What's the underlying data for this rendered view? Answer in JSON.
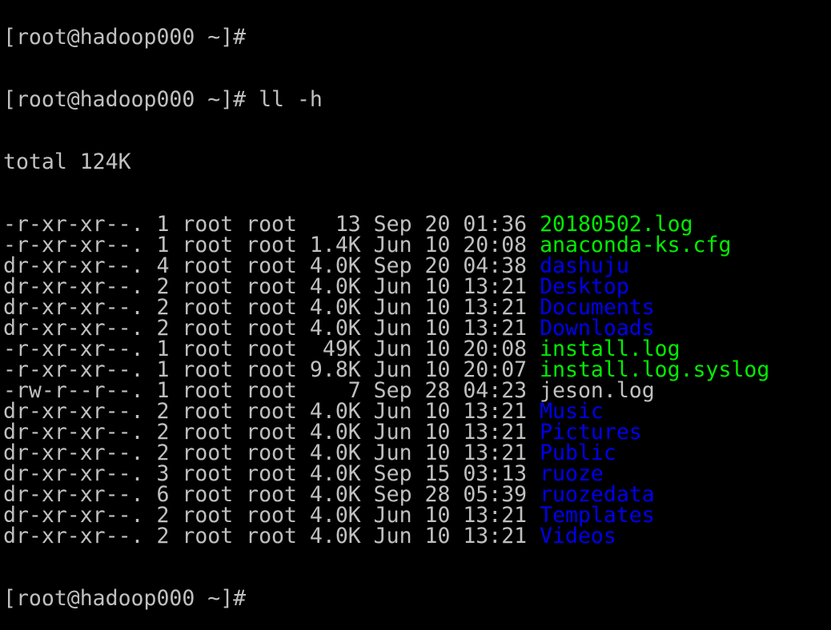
{
  "terminal": {
    "prev_prompt": "[root@hadoop000 ~]#",
    "prompt": "[root@hadoop000 ~]# ",
    "command": "ll -h",
    "total": "total 124K",
    "colors": {
      "normal": "#c0c0c0",
      "executable": "#00ee00",
      "directory": "#0000ee",
      "background": "#000000"
    },
    "entries": [
      {
        "perms": "-r-xr-xr--.",
        "links": "1",
        "owner": "root",
        "group": "root",
        "size": "  13",
        "month": "Sep",
        "day": "20",
        "time": "01:36",
        "name": "20180502.log",
        "type": "executable"
      },
      {
        "perms": "-r-xr-xr--.",
        "links": "1",
        "owner": "root",
        "group": "root",
        "size": "1.4K",
        "month": "Jun",
        "day": "10",
        "time": "20:08",
        "name": "anaconda-ks.cfg",
        "type": "executable"
      },
      {
        "perms": "dr-xr-xr--.",
        "links": "4",
        "owner": "root",
        "group": "root",
        "size": "4.0K",
        "month": "Sep",
        "day": "20",
        "time": "04:38",
        "name": "dashuju",
        "type": "directory"
      },
      {
        "perms": "dr-xr-xr--.",
        "links": "2",
        "owner": "root",
        "group": "root",
        "size": "4.0K",
        "month": "Jun",
        "day": "10",
        "time": "13:21",
        "name": "Desktop",
        "type": "directory"
      },
      {
        "perms": "dr-xr-xr--.",
        "links": "2",
        "owner": "root",
        "group": "root",
        "size": "4.0K",
        "month": "Jun",
        "day": "10",
        "time": "13:21",
        "name": "Documents",
        "type": "directory"
      },
      {
        "perms": "dr-xr-xr--.",
        "links": "2",
        "owner": "root",
        "group": "root",
        "size": "4.0K",
        "month": "Jun",
        "day": "10",
        "time": "13:21",
        "name": "Downloads",
        "type": "directory"
      },
      {
        "perms": "-r-xr-xr--.",
        "links": "1",
        "owner": "root",
        "group": "root",
        "size": " 49K",
        "month": "Jun",
        "day": "10",
        "time": "20:08",
        "name": "install.log",
        "type": "executable"
      },
      {
        "perms": "-r-xr-xr--.",
        "links": "1",
        "owner": "root",
        "group": "root",
        "size": "9.8K",
        "month": "Jun",
        "day": "10",
        "time": "20:07",
        "name": "install.log.syslog",
        "type": "executable"
      },
      {
        "perms": "-rw-r--r--.",
        "links": "1",
        "owner": "root",
        "group": "root",
        "size": "   7",
        "month": "Sep",
        "day": "28",
        "time": "04:23",
        "name": "jeson.log",
        "type": "normal"
      },
      {
        "perms": "dr-xr-xr--.",
        "links": "2",
        "owner": "root",
        "group": "root",
        "size": "4.0K",
        "month": "Jun",
        "day": "10",
        "time": "13:21",
        "name": "Music",
        "type": "directory"
      },
      {
        "perms": "dr-xr-xr--.",
        "links": "2",
        "owner": "root",
        "group": "root",
        "size": "4.0K",
        "month": "Jun",
        "day": "10",
        "time": "13:21",
        "name": "Pictures",
        "type": "directory"
      },
      {
        "perms": "dr-xr-xr--.",
        "links": "2",
        "owner": "root",
        "group": "root",
        "size": "4.0K",
        "month": "Jun",
        "day": "10",
        "time": "13:21",
        "name": "Public",
        "type": "directory"
      },
      {
        "perms": "dr-xr-xr--.",
        "links": "3",
        "owner": "root",
        "group": "root",
        "size": "4.0K",
        "month": "Sep",
        "day": "15",
        "time": "03:13",
        "name": "ruoze",
        "type": "directory"
      },
      {
        "perms": "dr-xr-xr--.",
        "links": "6",
        "owner": "root",
        "group": "root",
        "size": "4.0K",
        "month": "Sep",
        "day": "28",
        "time": "05:39",
        "name": "ruozedata",
        "type": "directory"
      },
      {
        "perms": "dr-xr-xr--.",
        "links": "2",
        "owner": "root",
        "group": "root",
        "size": "4.0K",
        "month": "Jun",
        "day": "10",
        "time": "13:21",
        "name": "Templates",
        "type": "directory"
      },
      {
        "perms": "dr-xr-xr--.",
        "links": "2",
        "owner": "root",
        "group": "root",
        "size": "4.0K",
        "month": "Jun",
        "day": "10",
        "time": "13:21",
        "name": "Videos",
        "type": "directory"
      }
    ],
    "final_prompt": "[root@hadoop000 ~]#"
  }
}
